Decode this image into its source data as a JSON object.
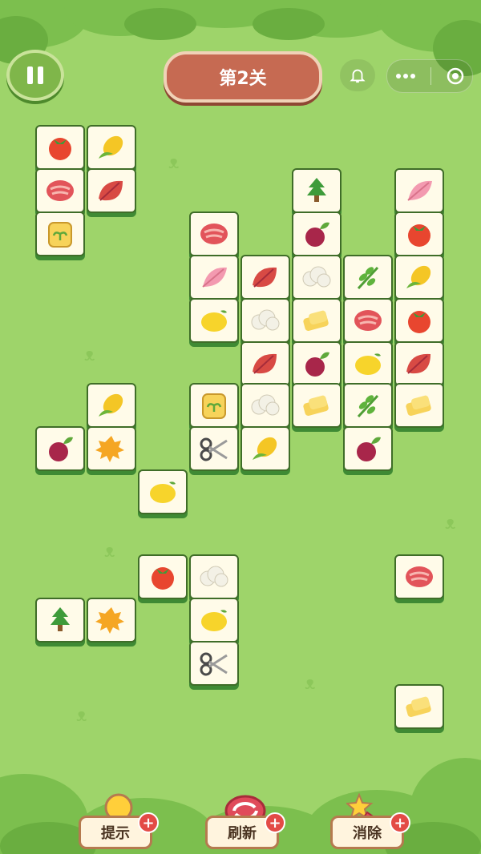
{
  "level": {
    "title": "第2关"
  },
  "toolbar": {
    "hint_label": "提示",
    "refresh_label": "刷新",
    "remove_label": "消除"
  },
  "tiles": [
    "tomato",
    "corn",
    "meat",
    "leaf",
    "seed-bag",
    "tree",
    "feather",
    "meat",
    "beet",
    "tomato",
    "feather",
    "leaf",
    "cauliflower",
    "herb",
    "corn",
    "lemon",
    "cauliflower",
    "cheese",
    "meat",
    "tomato",
    "leaf",
    "beet",
    "lemon",
    "leaf",
    "corn",
    "seed-bag",
    "cauliflower",
    "cheese",
    "herb",
    "cheese",
    "beet",
    "maple-leaf",
    "scissors",
    "corn",
    "beet",
    "lemon",
    "tomato",
    "cauliflower",
    "meat",
    "tree",
    "maple-leaf",
    "lemon",
    "scissors",
    "cheese"
  ],
  "colors": {
    "background": "#9ed46a",
    "tile_face": "#fffbe9",
    "tile_edge": "#3f8a34",
    "title_bg": "#c66a52"
  }
}
